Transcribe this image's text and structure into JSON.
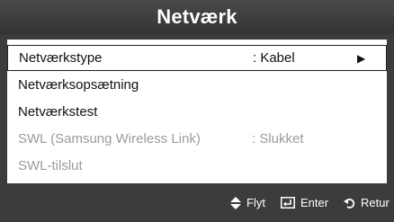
{
  "title": "Netværk",
  "menu": [
    {
      "label": "Netværkstype",
      "value": ": Kabel",
      "arrow": "▶",
      "state": "selected"
    },
    {
      "label": "Netværksopsætning",
      "value": "",
      "state": "normal"
    },
    {
      "label": "Netværkstest",
      "value": "",
      "state": "normal"
    },
    {
      "label": "SWL (Samsung Wireless Link)",
      "value": ": Slukket",
      "state": "disabled"
    },
    {
      "label": "SWL-tilslut",
      "value": "",
      "state": "disabled"
    }
  ],
  "footer": {
    "move": {
      "icon": "move-updown-icon",
      "label": "Flyt"
    },
    "enter": {
      "icon": "enter-icon",
      "label": "Enter"
    },
    "return": {
      "icon": "return-icon",
      "label": "Retur"
    }
  },
  "colors": {
    "background": "#3c3c3c",
    "panel": "#ffffff",
    "disabled_text": "#9b9b9b"
  }
}
